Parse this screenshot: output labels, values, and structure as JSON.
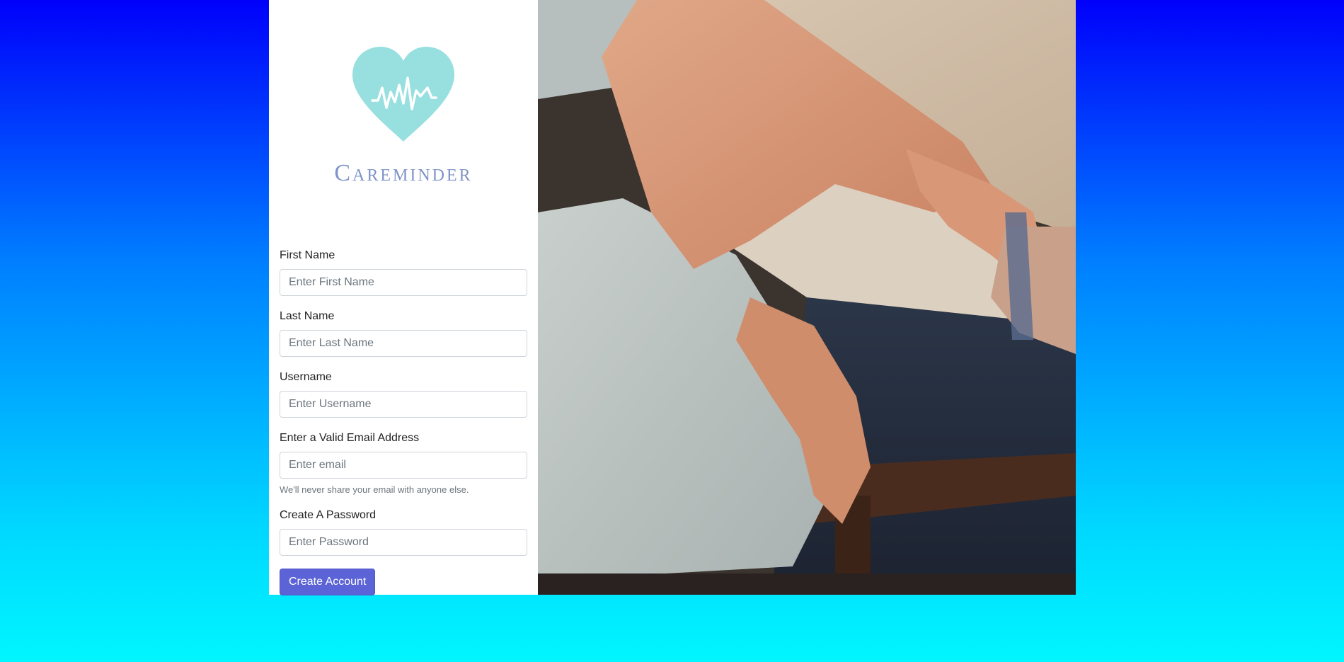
{
  "brand": {
    "name": "Careminder",
    "logo_icon": "heart-heartbeat-icon",
    "logo_color": "#98dfe0",
    "text_color": "#7f93c8"
  },
  "form": {
    "first_name": {
      "label": "First Name",
      "placeholder": "Enter First Name",
      "value": ""
    },
    "last_name": {
      "label": "Last Name",
      "placeholder": "Enter Last Name",
      "value": ""
    },
    "username": {
      "label": "Username",
      "placeholder": "Enter Username",
      "value": ""
    },
    "email": {
      "label": "Enter a Valid Email Address",
      "placeholder": "Enter email",
      "value": "",
      "help": "We'll never share your email with anyone else."
    },
    "password": {
      "label": "Create A Password",
      "placeholder": "Enter Password",
      "value": ""
    },
    "submit_label": "Create Account"
  },
  "colors": {
    "background_top": "#0000fb",
    "background_bottom": "#00f6ff",
    "button": "#5b63d6"
  },
  "photo": {
    "subject": "caregiver-holding-elderly-hand-photo"
  }
}
